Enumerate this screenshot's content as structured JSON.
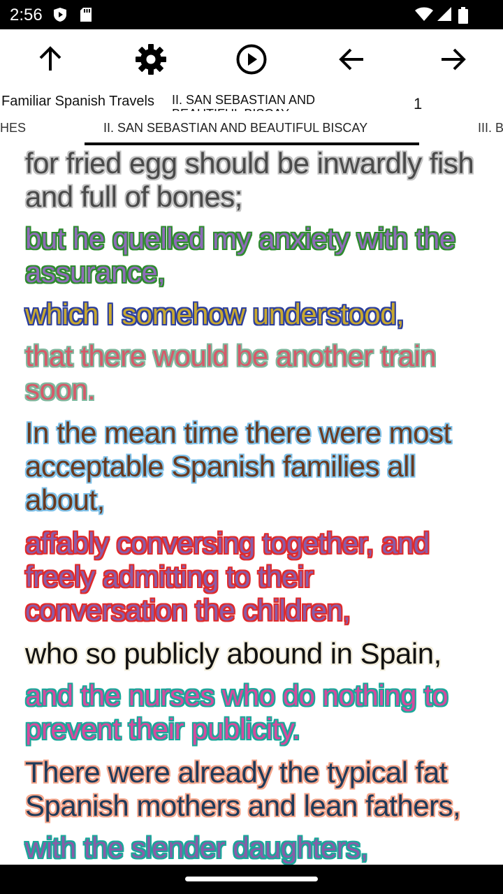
{
  "status": {
    "time": "2:56",
    "icons": [
      "play-protect-icon",
      "sd-card-icon",
      "wifi-icon",
      "signal-icon",
      "battery-icon"
    ]
  },
  "toolbar": {
    "buttons": [
      "arrow-up-icon",
      "settings-icon",
      "play-icon",
      "arrow-back-icon",
      "arrow-forward-icon"
    ]
  },
  "info": {
    "book_title": "Familiar Spanish Travels",
    "chapter_title": "II. SAN SEBASTIAN AND BEAUTIFUL BISCAY",
    "page_number": "1"
  },
  "tabs": {
    "prev": "HES",
    "active": "II. SAN SEBASTIAN AND BEAUTIFUL BISCAY",
    "next": "III. B"
  },
  "content": {
    "paragraphs": [
      {
        "text": "for fried egg should be inwardly fish and full of bones;",
        "fill": "#4a4a4a",
        "outline": "#c4c4c4"
      },
      {
        "text": " but he quelled my anxiety with the assurance,",
        "fill": "#8e6bb8",
        "outline": "#2e8b2e"
      },
      {
        "text": " which I somehow understood,",
        "fill": "#c8a830",
        "outline": "#2c3f9e"
      },
      {
        "text": " that there would be another train soon.",
        "fill": "#d65a6a",
        "outline": "#7fb89e"
      },
      {
        "text": " In the mean time there were most acceptable Spanish families all about,",
        "fill": "#6b3a1f",
        "outline": "#7fc2ea"
      },
      {
        "text": " affably conversing together, and freely admitting to their conversation the children,",
        "fill": "#8a5ca8",
        "outline": "#e02a2a"
      },
      {
        "text": " who so publicly abound in Spain,",
        "fill": "#111111",
        "outline": "#f3eedd"
      },
      {
        "text": " and the nurses who do nothing to prevent their publicity.",
        "fill": "#d64a9e",
        "outline": "#1aa89a"
      },
      {
        "text": " There were already the typical fat Spanish mothers and lean fathers,",
        "fill": "#1e3a5a",
        "outline": "#f4a58a"
      },
      {
        "text": " with the slender daughters,",
        "fill": "#8a5ca8",
        "outline": "#1aa89a"
      }
    ]
  }
}
